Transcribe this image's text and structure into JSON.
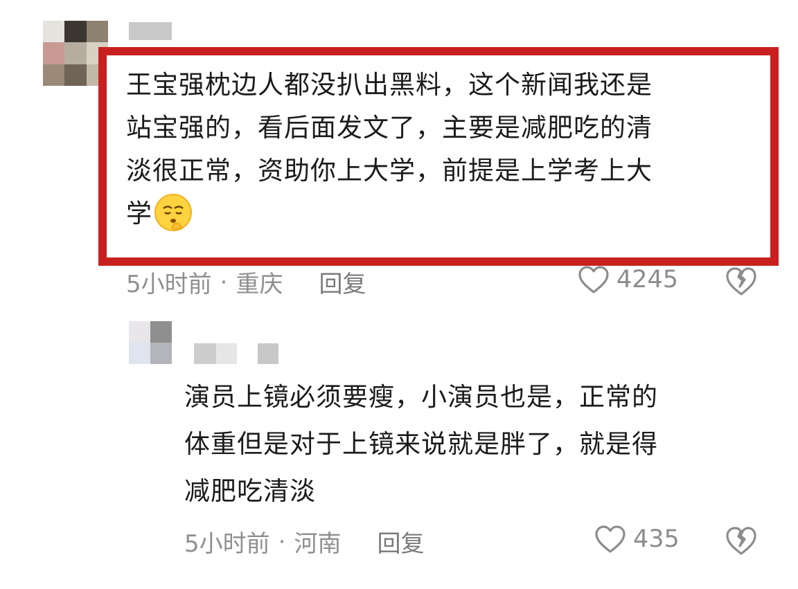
{
  "comment": {
    "lines": [
      "王宝强枕边人都没扒出黑料，这个新闻我还是",
      "站宝强的，看后面发文了，主要是减肥吃的清",
      "淡很正常，资助你上大学，前提是上学考上大",
      "学"
    ],
    "emoji_icon": "shushing-face-emoji",
    "time": "5小时前",
    "separator": "·",
    "location": "重庆",
    "reply_label": "回复",
    "like_count": "4245",
    "highlight_color": "#c8201f"
  },
  "reply_comment": {
    "lines": [
      "演员上镜必须要瘦，小演员也是，正常的",
      "体重但是对于上镜来说就是胖了，就是得",
      "减肥吃清淡"
    ],
    "time": "5小时前",
    "separator": "·",
    "location": "河南",
    "reply_label": "回复",
    "like_count": "435"
  },
  "icons": {
    "like": "heart-outline-icon",
    "dislike": "broken-heart-icon"
  }
}
